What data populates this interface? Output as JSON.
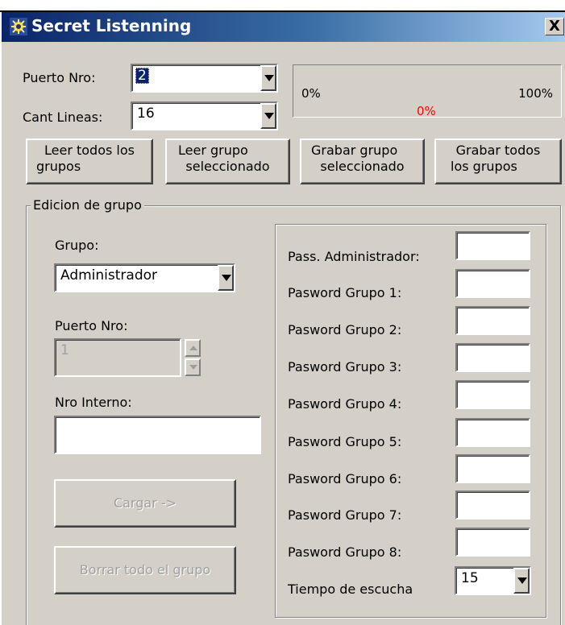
{
  "window": {
    "title": "Secret Listenning",
    "close_label": "X"
  },
  "top": {
    "puerto_label": "Puerto Nro:",
    "puerto_value": "2",
    "lineas_label": "Cant Lineas:",
    "lineas_value": "16"
  },
  "progress": {
    "min_label": "0%",
    "max_label": "100%",
    "current_label": "0%",
    "current_color": "#ff0000",
    "fraction": 0.0
  },
  "buttons": {
    "leer_todos": [
      "Leer todos los",
      "grupos"
    ],
    "leer_grupo": [
      "Leer grupo",
      "seleccionado"
    ],
    "grabar_grupo": [
      "Grabar grupo",
      "seleccionado"
    ],
    "grabar_todos": [
      "Grabar todos",
      "los grupos"
    ]
  },
  "edicion": {
    "legend": "Edicion de grupo",
    "grupo_label": "Grupo:",
    "grupo_value": "Administrador",
    "puerto_label": "Puerto Nro:",
    "puerto_value": "1",
    "interno_label": "Nro Interno:",
    "interno_value": "",
    "cargar_label": "Cargar ->",
    "borrar_label": "Borrar todo el grupo"
  },
  "passwords": {
    "admin_label": "Pass. Administrador:",
    "grupo_labels": [
      "Pasword Grupo 1:",
      "Pasword Grupo 2:",
      "Pasword Grupo 3:",
      "Pasword Grupo 4:",
      "Pasword Grupo 5:",
      "Pasword Grupo 6:",
      "Pasword Grupo 7:",
      "Pasword Grupo 8:"
    ],
    "tiempo_label": "Tiempo de escucha",
    "tiempo_value": "15"
  }
}
